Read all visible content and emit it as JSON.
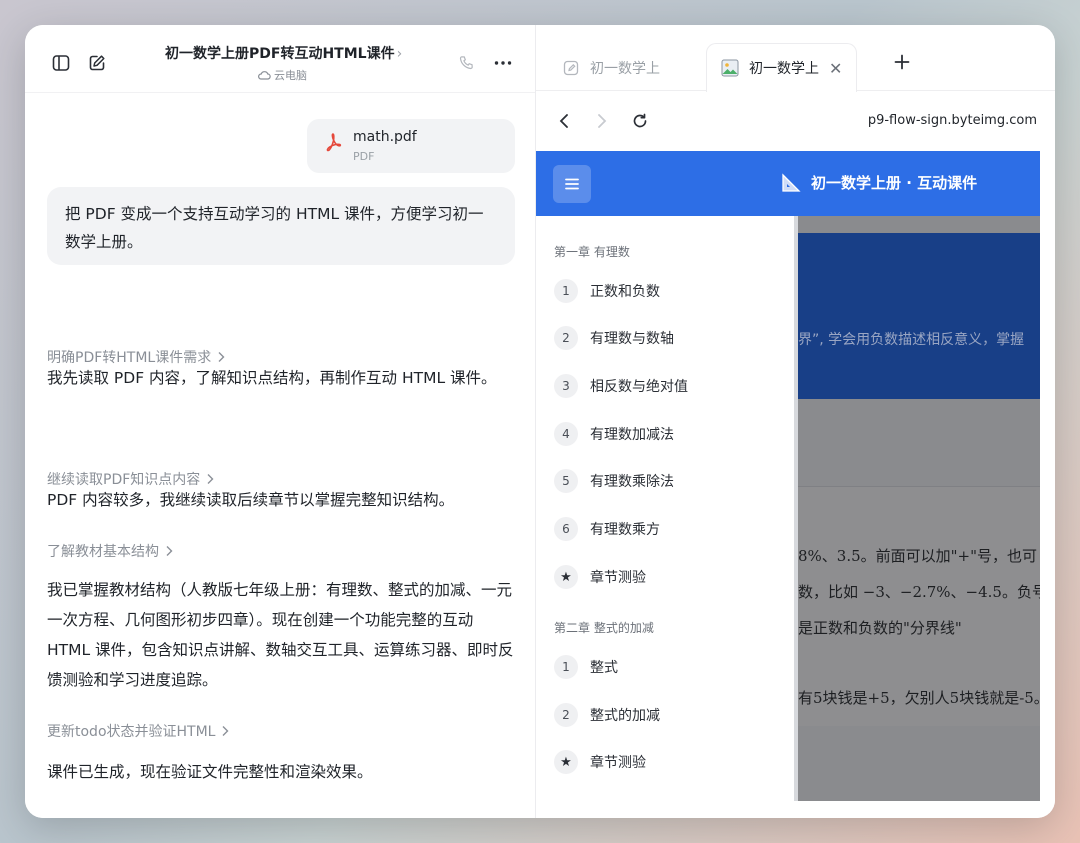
{
  "chat": {
    "title": "初一数学上册PDF转互动HTML课件",
    "title_chevron": "›",
    "subtitle": "云电脑",
    "file": {
      "name": "math.pdf",
      "type": "PDF"
    },
    "user_message": "把 PDF 变成一个支持互动学习的 HTML 课件，方便学习初一数学上册。",
    "steps": [
      {
        "link": "明确PDF转HTML课件需求",
        "text": "我先读取 PDF 内容，了解知识点结构，再制作互动 HTML 课件。"
      },
      {
        "link": "继续读取PDF知识点内容",
        "text": "PDF 内容较多，我继续读取后续章节以掌握完整知识结构。"
      },
      {
        "link": "了解教材基本结构",
        "text": "我已掌握教材结构（人教版七年级上册：有理数、整式的加减、一元一次方程、几何图形初步四章）。现在创建一个功能完整的互动 HTML 课件，包含知识点讲解、数轴交互工具、运算练习器、即时反馈测验和学习进度追踪。"
      },
      {
        "link": "更新todo状态并验证HTML",
        "text": "课件已生成，现在验证文件完整性和渲染效果。"
      }
    ]
  },
  "browser": {
    "tabs": [
      {
        "label": "初一数学上",
        "active": false
      },
      {
        "label": "初一数学上",
        "active": true
      }
    ],
    "url": "p9-flow-sign.byteimg.com",
    "page": {
      "course_title": "初一数学上册 · 互动课件",
      "chapters": [
        {
          "title": "第一章 有理数",
          "items": [
            {
              "num": "1",
              "label": "正数和负数"
            },
            {
              "num": "2",
              "label": "有理数与数轴"
            },
            {
              "num": "3",
              "label": "相反数与绝对值"
            },
            {
              "num": "4",
              "label": "有理数加减法"
            },
            {
              "num": "5",
              "label": "有理数乘除法"
            },
            {
              "num": "6",
              "label": "有理数乘方"
            },
            {
              "num": "★",
              "label": "章节测验"
            }
          ]
        },
        {
          "title": "第二章 整式的加减",
          "items": [
            {
              "num": "1",
              "label": "整式"
            },
            {
              "num": "2",
              "label": "整式的加减"
            },
            {
              "num": "★",
              "label": "章节测验"
            }
          ]
        }
      ],
      "bg_hero_text": "界”, 学会用负数描述相反意义，掌握",
      "bg_lines": [
        "8%、3.5。前面可以加\"+\"号，也可",
        "数，比如 −3、−2.7%、−4.5。负号",
        "是正数和负数的\"分界线\"",
        "有5块钱是+5，欠别人5块钱就是-5。"
      ]
    }
  }
}
